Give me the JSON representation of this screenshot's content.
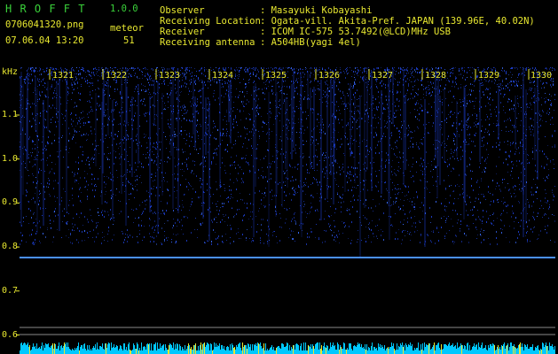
{
  "header": {
    "app_name": "H R O F F T",
    "version": "1.0.0",
    "filename": "0706041320.png",
    "meteor_label": "meteor",
    "datetime": "07.06.04 13:20",
    "meteor_count": "51",
    "fields": [
      {
        "label": "Observer",
        "value": ": Masayuki Kobayashi"
      },
      {
        "label": "Receiving Location",
        "value": ": Ogata-vill. Akita-Pref. JAPAN (139.96E, 40.02N)"
      },
      {
        "label": "Receiver",
        "value": ": ICOM IC-575 53.7492(@LCD)MHz USB"
      },
      {
        "label": "Receiving antenna",
        "value": ": A504HB(yagi 4el)"
      }
    ]
  },
  "axis": {
    "unit": "kHz",
    "y_ticks": [
      "1.1",
      "1.0",
      "0.9",
      "0.8",
      "0.7",
      "0.6"
    ],
    "x_ticks": [
      "1321",
      "1322",
      "1323",
      "1324",
      "1325",
      "1326",
      "1327",
      "1328",
      "1329",
      "1330"
    ]
  },
  "colors": {
    "background": "#000000",
    "text_green": "#3ad13a",
    "text_yellow": "#e8e830",
    "noise": "#1c3cc8",
    "trace": "#4a90ff",
    "baseline": "#00c8ff"
  }
}
